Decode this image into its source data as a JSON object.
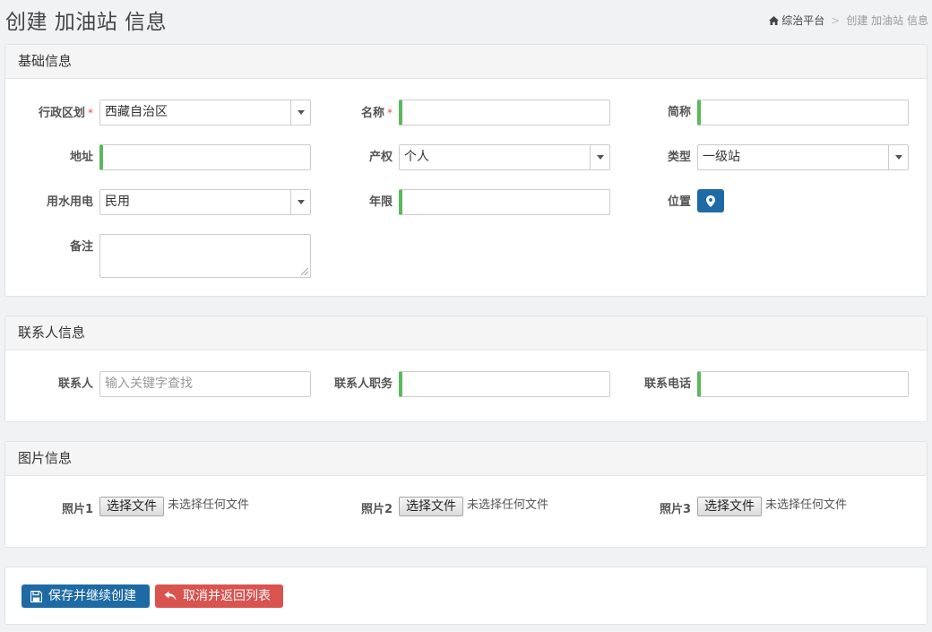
{
  "header": {
    "title": "创建 加油站 信息",
    "breadcrumb": {
      "home": "综治平台",
      "separator": ">",
      "current": "创建 加油站 信息"
    }
  },
  "basic": {
    "title": "基础信息",
    "required_mark": "*",
    "region": {
      "label": "行政区划",
      "value": "西藏自治区"
    },
    "name": {
      "label": "名称",
      "value": ""
    },
    "short_name": {
      "label": "简称",
      "value": ""
    },
    "address": {
      "label": "地址",
      "value": ""
    },
    "ownership": {
      "label": "产权",
      "value": "个人"
    },
    "type": {
      "label": "类型",
      "value": "一级站"
    },
    "utility": {
      "label": "用水用电",
      "value": "民用"
    },
    "years": {
      "label": "年限",
      "value": ""
    },
    "location": {
      "label": "位置"
    },
    "remark": {
      "label": "备注",
      "value": ""
    }
  },
  "contact": {
    "title": "联系人信息",
    "person": {
      "label": "联系人",
      "placeholder": "输入关键字查找"
    },
    "position": {
      "label": "联系人职务",
      "value": ""
    },
    "phone": {
      "label": "联系电话",
      "value": ""
    }
  },
  "photos": {
    "title": "图片信息",
    "button_label": "选择文件",
    "status": "未选择任何文件",
    "items": [
      {
        "label": "照片1"
      },
      {
        "label": "照片2"
      },
      {
        "label": "照片3"
      }
    ]
  },
  "actions": {
    "save_label": "保存并继续创建",
    "cancel_label": "取消并返回列表"
  },
  "colors": {
    "primary": "#1e6aa5",
    "danger": "#d9534f",
    "valid_green": "#5cb85c",
    "required": "#d9534f"
  },
  "icons": {
    "home": "home-icon",
    "location": "map-marker-icon",
    "save": "floppy-disk-icon",
    "cancel": "undo-arrow-icon"
  }
}
